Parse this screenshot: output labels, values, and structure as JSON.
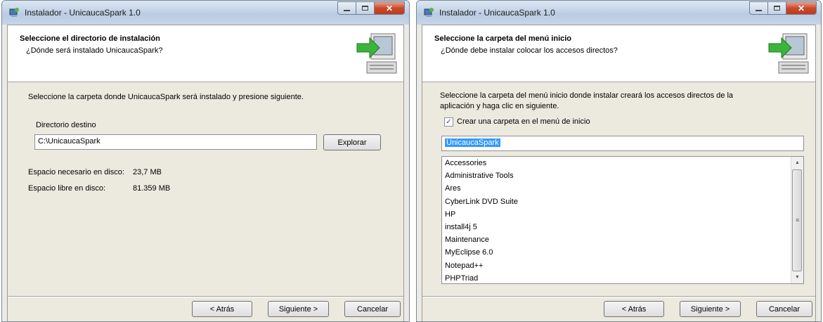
{
  "window1": {
    "title": "Instalador - UnicaucaSpark 1.0",
    "header_title": "Seleccione el directorio de instalación",
    "header_subtitle": "¿Dónde será instalado UnicaucaSpark?",
    "instruction": "Seleccione la carpeta donde UnicaucaSpark será instalado y presione siguiente.",
    "dest_label": "Directorio destino",
    "dest_value": "C:\\UnicaucaSpark",
    "browse_label": "Explorar",
    "space_required_label": "Espacio necesario en disco:",
    "space_required_value": "23,7 MB",
    "space_free_label": "Espacio libre en disco:",
    "space_free_value": "81.359 MB",
    "back_label": "< Atrás",
    "next_label": "Siguiente >",
    "cancel_label": "Cancelar"
  },
  "window2": {
    "title": "Instalador - UnicaucaSpark 1.0",
    "header_title": "Seleccione la carpeta del menú inicio",
    "header_subtitle": "¿Dónde debe instalar colocar los accesos directos?",
    "instruction_line1": "Seleccione la carpeta del menú inicio donde instalar creará los accesos directos de la",
    "instruction_line2": "aplicación y haga clic en siguiente.",
    "checkbox_label": "Crear una carpeta en el menú de inicio",
    "checkbox_checked": true,
    "folder_value": "UnicaucaSpark",
    "list_items": [
      "Accessories",
      "Administrative Tools",
      "Ares",
      "CyberLink DVD Suite",
      "HP",
      "install4j 5",
      "Maintenance",
      "MyEclipse 6.0",
      "Notepad++",
      "PHPTriad"
    ],
    "back_label": "< Atrás",
    "next_label": "Siguiente >",
    "cancel_label": "Cancelar"
  }
}
